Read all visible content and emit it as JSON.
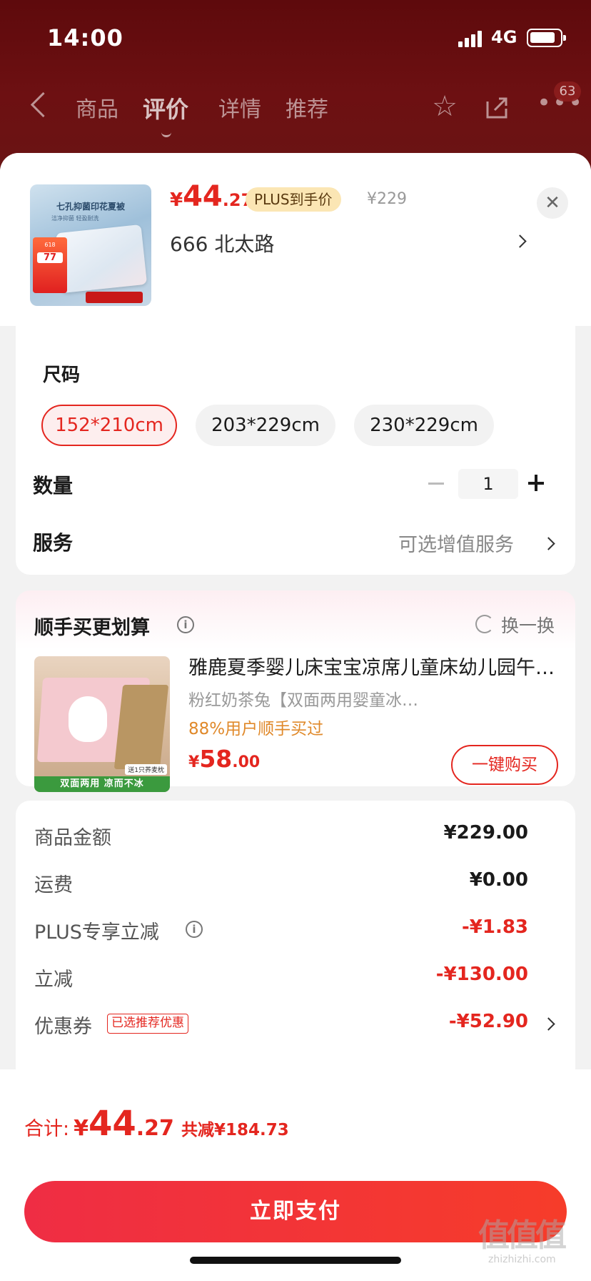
{
  "status_bar": {
    "time": "14:00",
    "network": "4G"
  },
  "nav": {
    "tabs": [
      "商品",
      "评价",
      "详情",
      "推荐"
    ],
    "active_tab": "评价",
    "badge": "63",
    "icons": [
      "back-icon",
      "star-icon",
      "share-icon",
      "more-icon"
    ]
  },
  "product": {
    "thumbnail_title": "七孔抑菌印花夏被",
    "thumbnail_sub": "洁净抑菌  轻盈耐洗",
    "thumbnail_tag": "618",
    "thumbnail_tag_price": "77",
    "price_symbol": "¥",
    "price_int": "44",
    "price_dec": ".27",
    "plus_tag": "PLUS到手价",
    "original_price": "¥229",
    "address": "666  北太路"
  },
  "options": {
    "size_title": "尺码",
    "sizes": [
      "152*210cm",
      "203*229cm",
      "230*229cm"
    ],
    "selected_size": "152*210cm",
    "quantity_label": "数量",
    "quantity": "1",
    "service_label": "服务",
    "service_value": "可选增值服务"
  },
  "recommend": {
    "title": "顺手买更划算",
    "refresh_label": "换一换",
    "image_strip": "双面两用  凉而不冰",
    "image_tag": "送1只荞麦枕",
    "name": "雅鹿夏季婴儿床宝宝凉席儿童床幼儿园午睡席子",
    "sku": "粉红奶茶兔【双面两用婴童冰丝凉席】",
    "bought": "88%用户顺手买过",
    "price_symbol": "¥",
    "price_int": "58",
    "price_dec": ".00",
    "buy_label": "一键购买"
  },
  "summary": {
    "rows": [
      {
        "label": "商品金额",
        "value": "¥229.00"
      },
      {
        "label": "运费",
        "value": "¥0.00"
      },
      {
        "label": "PLUS专享立减",
        "value": "-¥1.83"
      },
      {
        "label": "立减",
        "value": "-¥130.00"
      },
      {
        "label": "优惠券",
        "value": "-¥52.90"
      }
    ],
    "coupon_tag": "已选推荐优惠"
  },
  "footer": {
    "total_label": "合计:",
    "total_symbol": "¥",
    "total_int": "44",
    "total_dec": ".27",
    "saved": "共减¥184.73",
    "pay_label": "立即支付",
    "watermark": "值值值",
    "watermark_sub": "zhizhizhi.com"
  },
  "colors": {
    "accent": "#e4261f",
    "plus_tag_bg": "#fbe6b4",
    "bought": "#e0892a"
  }
}
